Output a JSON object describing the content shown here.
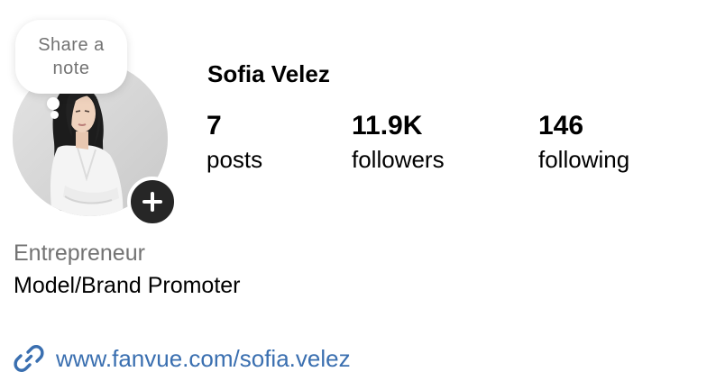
{
  "note": {
    "text": "Share a note"
  },
  "profile": {
    "name": "Sofia Velez",
    "avatar_alt": "profile photo"
  },
  "stats": [
    {
      "value": "7",
      "label": "posts"
    },
    {
      "value": "11.9K",
      "label": "followers"
    },
    {
      "value": "146",
      "label": "following"
    }
  ],
  "bio": {
    "category": "Entrepreneur",
    "text": "Model/Brand Promoter",
    "link": "www.fanvue.com/sofia.velez"
  },
  "icons": {
    "add_story": "plus-icon",
    "link": "link-icon"
  },
  "colors": {
    "link": "#3a6fb0",
    "muted_text": "#737373",
    "add_button": "#262626"
  }
}
